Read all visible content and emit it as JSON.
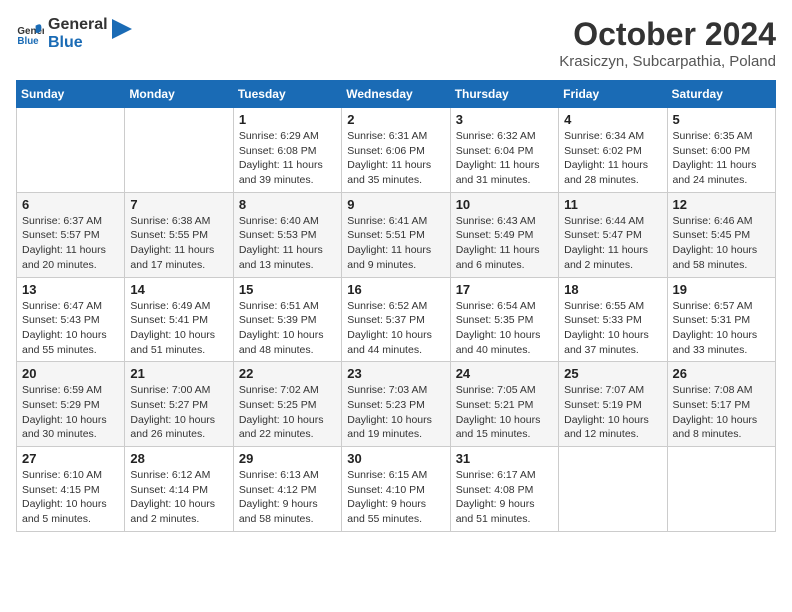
{
  "header": {
    "logo_general": "General",
    "logo_blue": "Blue",
    "month_title": "October 2024",
    "subtitle": "Krasiczyn, Subcarpathia, Poland"
  },
  "days_of_week": [
    "Sunday",
    "Monday",
    "Tuesday",
    "Wednesday",
    "Thursday",
    "Friday",
    "Saturday"
  ],
  "weeks": [
    [
      null,
      null,
      {
        "day": "1",
        "sunrise": "Sunrise: 6:29 AM",
        "sunset": "Sunset: 6:08 PM",
        "daylight": "Daylight: 11 hours and 39 minutes."
      },
      {
        "day": "2",
        "sunrise": "Sunrise: 6:31 AM",
        "sunset": "Sunset: 6:06 PM",
        "daylight": "Daylight: 11 hours and 35 minutes."
      },
      {
        "day": "3",
        "sunrise": "Sunrise: 6:32 AM",
        "sunset": "Sunset: 6:04 PM",
        "daylight": "Daylight: 11 hours and 31 minutes."
      },
      {
        "day": "4",
        "sunrise": "Sunrise: 6:34 AM",
        "sunset": "Sunset: 6:02 PM",
        "daylight": "Daylight: 11 hours and 28 minutes."
      },
      {
        "day": "5",
        "sunrise": "Sunrise: 6:35 AM",
        "sunset": "Sunset: 6:00 PM",
        "daylight": "Daylight: 11 hours and 24 minutes."
      }
    ],
    [
      {
        "day": "6",
        "sunrise": "Sunrise: 6:37 AM",
        "sunset": "Sunset: 5:57 PM",
        "daylight": "Daylight: 11 hours and 20 minutes."
      },
      {
        "day": "7",
        "sunrise": "Sunrise: 6:38 AM",
        "sunset": "Sunset: 5:55 PM",
        "daylight": "Daylight: 11 hours and 17 minutes."
      },
      {
        "day": "8",
        "sunrise": "Sunrise: 6:40 AM",
        "sunset": "Sunset: 5:53 PM",
        "daylight": "Daylight: 11 hours and 13 minutes."
      },
      {
        "day": "9",
        "sunrise": "Sunrise: 6:41 AM",
        "sunset": "Sunset: 5:51 PM",
        "daylight": "Daylight: 11 hours and 9 minutes."
      },
      {
        "day": "10",
        "sunrise": "Sunrise: 6:43 AM",
        "sunset": "Sunset: 5:49 PM",
        "daylight": "Daylight: 11 hours and 6 minutes."
      },
      {
        "day": "11",
        "sunrise": "Sunrise: 6:44 AM",
        "sunset": "Sunset: 5:47 PM",
        "daylight": "Daylight: 11 hours and 2 minutes."
      },
      {
        "day": "12",
        "sunrise": "Sunrise: 6:46 AM",
        "sunset": "Sunset: 5:45 PM",
        "daylight": "Daylight: 10 hours and 58 minutes."
      }
    ],
    [
      {
        "day": "13",
        "sunrise": "Sunrise: 6:47 AM",
        "sunset": "Sunset: 5:43 PM",
        "daylight": "Daylight: 10 hours and 55 minutes."
      },
      {
        "day": "14",
        "sunrise": "Sunrise: 6:49 AM",
        "sunset": "Sunset: 5:41 PM",
        "daylight": "Daylight: 10 hours and 51 minutes."
      },
      {
        "day": "15",
        "sunrise": "Sunrise: 6:51 AM",
        "sunset": "Sunset: 5:39 PM",
        "daylight": "Daylight: 10 hours and 48 minutes."
      },
      {
        "day": "16",
        "sunrise": "Sunrise: 6:52 AM",
        "sunset": "Sunset: 5:37 PM",
        "daylight": "Daylight: 10 hours and 44 minutes."
      },
      {
        "day": "17",
        "sunrise": "Sunrise: 6:54 AM",
        "sunset": "Sunset: 5:35 PM",
        "daylight": "Daylight: 10 hours and 40 minutes."
      },
      {
        "day": "18",
        "sunrise": "Sunrise: 6:55 AM",
        "sunset": "Sunset: 5:33 PM",
        "daylight": "Daylight: 10 hours and 37 minutes."
      },
      {
        "day": "19",
        "sunrise": "Sunrise: 6:57 AM",
        "sunset": "Sunset: 5:31 PM",
        "daylight": "Daylight: 10 hours and 33 minutes."
      }
    ],
    [
      {
        "day": "20",
        "sunrise": "Sunrise: 6:59 AM",
        "sunset": "Sunset: 5:29 PM",
        "daylight": "Daylight: 10 hours and 30 minutes."
      },
      {
        "day": "21",
        "sunrise": "Sunrise: 7:00 AM",
        "sunset": "Sunset: 5:27 PM",
        "daylight": "Daylight: 10 hours and 26 minutes."
      },
      {
        "day": "22",
        "sunrise": "Sunrise: 7:02 AM",
        "sunset": "Sunset: 5:25 PM",
        "daylight": "Daylight: 10 hours and 22 minutes."
      },
      {
        "day": "23",
        "sunrise": "Sunrise: 7:03 AM",
        "sunset": "Sunset: 5:23 PM",
        "daylight": "Daylight: 10 hours and 19 minutes."
      },
      {
        "day": "24",
        "sunrise": "Sunrise: 7:05 AM",
        "sunset": "Sunset: 5:21 PM",
        "daylight": "Daylight: 10 hours and 15 minutes."
      },
      {
        "day": "25",
        "sunrise": "Sunrise: 7:07 AM",
        "sunset": "Sunset: 5:19 PM",
        "daylight": "Daylight: 10 hours and 12 minutes."
      },
      {
        "day": "26",
        "sunrise": "Sunrise: 7:08 AM",
        "sunset": "Sunset: 5:17 PM",
        "daylight": "Daylight: 10 hours and 8 minutes."
      }
    ],
    [
      {
        "day": "27",
        "sunrise": "Sunrise: 6:10 AM",
        "sunset": "Sunset: 4:15 PM",
        "daylight": "Daylight: 10 hours and 5 minutes."
      },
      {
        "day": "28",
        "sunrise": "Sunrise: 6:12 AM",
        "sunset": "Sunset: 4:14 PM",
        "daylight": "Daylight: 10 hours and 2 minutes."
      },
      {
        "day": "29",
        "sunrise": "Sunrise: 6:13 AM",
        "sunset": "Sunset: 4:12 PM",
        "daylight": "Daylight: 9 hours and 58 minutes."
      },
      {
        "day": "30",
        "sunrise": "Sunrise: 6:15 AM",
        "sunset": "Sunset: 4:10 PM",
        "daylight": "Daylight: 9 hours and 55 minutes."
      },
      {
        "day": "31",
        "sunrise": "Sunrise: 6:17 AM",
        "sunset": "Sunset: 4:08 PM",
        "daylight": "Daylight: 9 hours and 51 minutes."
      },
      null,
      null
    ]
  ]
}
